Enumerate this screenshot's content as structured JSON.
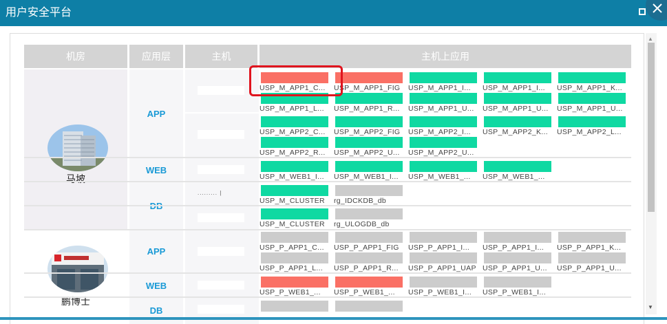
{
  "window": {
    "title": "用户安全平台"
  },
  "columns": [
    "机房",
    "应用层",
    "主机",
    "主机上应用"
  ],
  "colors": {
    "red": "#fa7065",
    "green": "#0fd9a2",
    "gray": "#cccccc",
    "title_bar": "#0e7fa6"
  },
  "rooms": [
    {
      "name": "马坡",
      "photo": "building-photo"
    },
    {
      "name": "鹏博士",
      "photo": "storefront-photo"
    }
  ],
  "layers": [
    "APP",
    "WEB",
    "DB",
    "APP",
    "WEB",
    "DB"
  ],
  "hosts": [
    {
      "text": ""
    },
    {
      "text": ""
    },
    {
      "text": ""
    },
    {
      "text": "......... |"
    },
    {
      "text": ""
    },
    {
      "text": ""
    },
    {
      "text": ""
    },
    {
      "text": ""
    },
    {
      "text": ""
    }
  ],
  "apps": [
    {
      "label": "USP_M_APP1_C...",
      "status": "red"
    },
    {
      "label": "USP_M_APP1_FIG",
      "status": "red"
    },
    {
      "label": "USP_M_APP1_I...",
      "status": "green"
    },
    {
      "label": "USP_M_APP1_I...",
      "status": "green"
    },
    {
      "label": "USP_M_APP1_K...",
      "status": "green"
    },
    {
      "label": "USP_M_APP1_L...",
      "status": "green"
    },
    {
      "label": "USP_M_APP1_R...",
      "status": "green"
    },
    {
      "label": "USP_M_APP1_U...",
      "status": "green"
    },
    {
      "label": "USP_M_APP1_U...",
      "status": "green"
    },
    {
      "label": "USP_M_APP1_U...",
      "status": "green"
    },
    {
      "label": "USP_M_APP2_C...",
      "status": "green"
    },
    {
      "label": "USP_M_APP2_FIG",
      "status": "green"
    },
    {
      "label": "USP_M_APP2_I...",
      "status": "green"
    },
    {
      "label": "USP_M_APP2_K...",
      "status": "green"
    },
    {
      "label": "USP_M_APP2_L...",
      "status": "green"
    },
    {
      "label": "USP_M_APP2_R...",
      "status": "green"
    },
    {
      "label": "USP_M_APP2_U...",
      "status": "green"
    },
    {
      "label": "USP_M_APP2_U...",
      "status": "green"
    },
    {
      "label": "USP_M_WEB1_I...",
      "status": "green"
    },
    {
      "label": "USP_M_WEB1_I...",
      "status": "green"
    },
    {
      "label": "USP_M_WEB1_...",
      "status": "green"
    },
    {
      "label": "USP_M_WEB1_...",
      "status": "green"
    },
    {
      "label": "USP_M_CLUSTER",
      "status": "green"
    },
    {
      "label": "rg_IDCKDB_db",
      "status": "gray"
    },
    {
      "label": "USP_M_CLUSTER",
      "status": "green"
    },
    {
      "label": "rg_ULOGDB_db",
      "status": "gray"
    },
    {
      "label": "USP_P_APP1_C...",
      "status": "gray"
    },
    {
      "label": "USP_P_APP1_FIG",
      "status": "gray"
    },
    {
      "label": "USP_P_APP1_I...",
      "status": "gray"
    },
    {
      "label": "USP_P_APP1_I...",
      "status": "gray"
    },
    {
      "label": "USP_P_APP1_K...",
      "status": "gray"
    },
    {
      "label": "USP_P_APP1_L...",
      "status": "gray"
    },
    {
      "label": "USP_P_APP1_R...",
      "status": "gray"
    },
    {
      "label": "USP_P_APP1_UAP",
      "status": "gray"
    },
    {
      "label": "USP_P_APP1_U...",
      "status": "gray"
    },
    {
      "label": "USP_P_APP1_U...",
      "status": "gray"
    },
    {
      "label": "USP_P_WEB1_...",
      "status": "red"
    },
    {
      "label": "USP_P_WEB1_...",
      "status": "red"
    },
    {
      "label": "USP_P_WEB1_I...",
      "status": "gray"
    },
    {
      "label": "USP_P_WEB1_I...",
      "status": "gray"
    },
    {
      "label": "",
      "status": "gray"
    },
    {
      "label": "",
      "status": "gray"
    }
  ]
}
